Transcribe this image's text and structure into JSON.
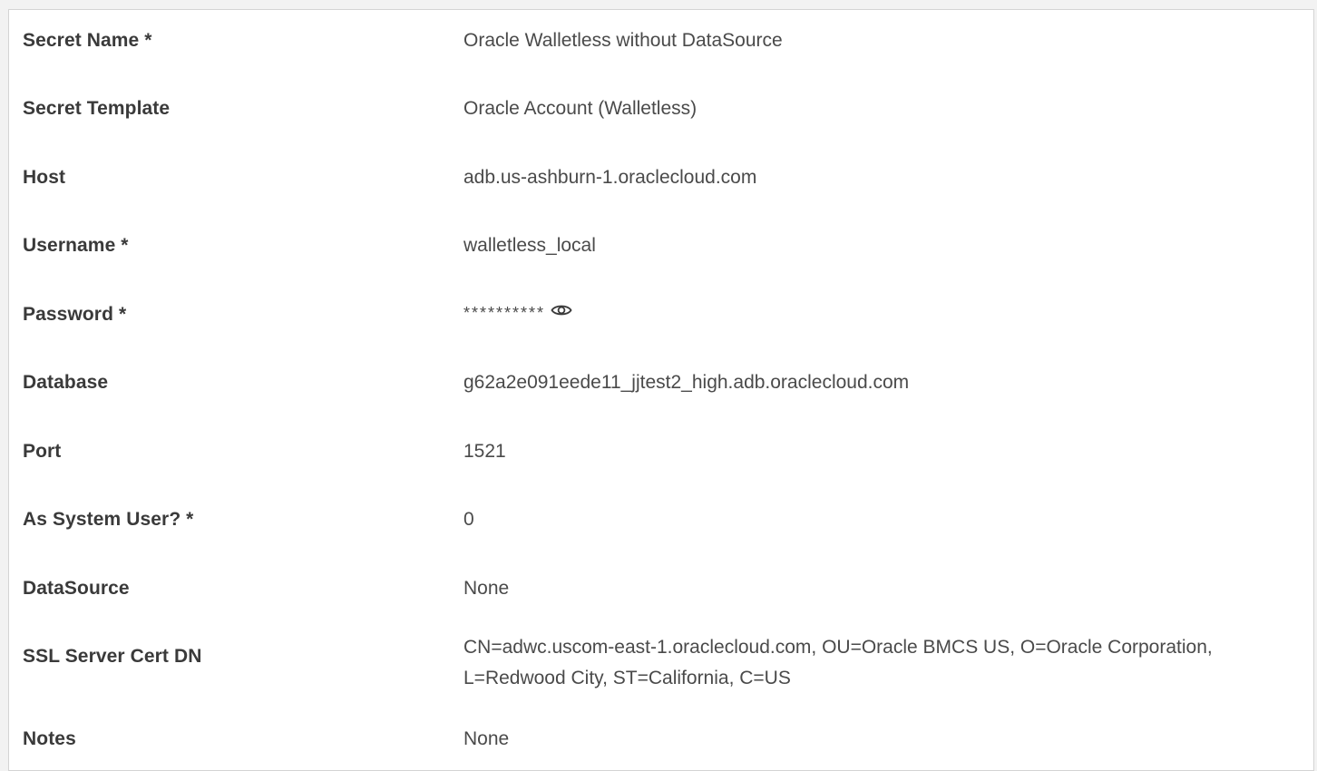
{
  "colors": {
    "label": "#3a3a3a",
    "value": "#4a4a4a",
    "border": "#d4d4d4",
    "background": "#ffffff"
  },
  "fields": [
    {
      "label": "Secret Name *",
      "value": "Oracle Walletless without DataSource"
    },
    {
      "label": "Secret Template",
      "value": "Oracle Account (Walletless)"
    },
    {
      "label": "Host",
      "value": "adb.us-ashburn-1.oraclecloud.com"
    },
    {
      "label": "Username *",
      "value": "walletless_local"
    },
    {
      "label": "Password *",
      "value": "**********",
      "icon": "eye-icon"
    },
    {
      "label": "Database",
      "value": "g62a2e091eede11_jjtest2_high.adb.oraclecloud.com"
    },
    {
      "label": "Port",
      "value": "1521"
    },
    {
      "label": "As System User? *",
      "value": "0"
    },
    {
      "label": "DataSource",
      "value": "None"
    },
    {
      "label": "SSL Server Cert DN",
      "value_lines": [
        "CN=adwc.uscom-east-1.oraclecloud.com, OU=Oracle BMCS US, O=Oracle Corporation,",
        "L=Redwood City, ST=California, C=US"
      ]
    },
    {
      "label": "Notes",
      "value": "None"
    }
  ]
}
